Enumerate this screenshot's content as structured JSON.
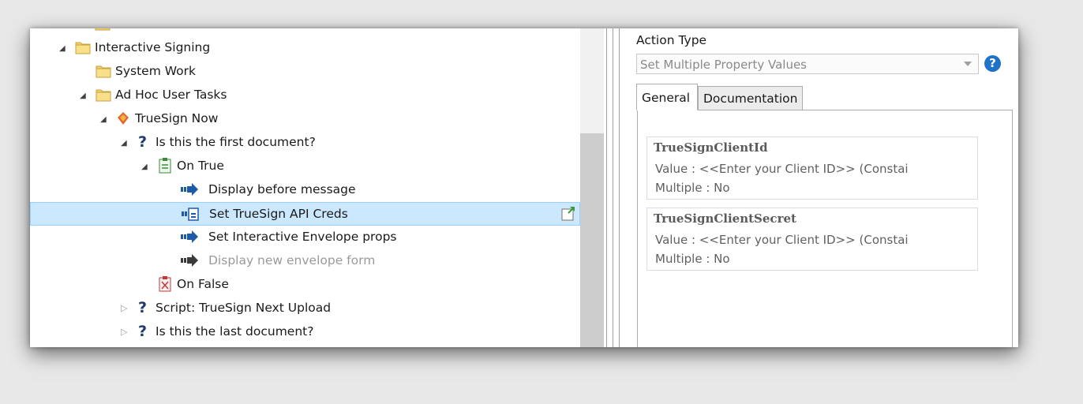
{
  "tree": {
    "items": [
      {
        "label": "Interactive Signing"
      },
      {
        "label": "System Work"
      },
      {
        "label": "Ad Hoc User Tasks"
      },
      {
        "label": "TrueSign Now"
      },
      {
        "label": "Is this the first document?"
      },
      {
        "label": "On True"
      },
      {
        "label": "Display before message"
      },
      {
        "label": "Set TrueSign API Creds"
      },
      {
        "label": "Set Interactive Envelope props"
      },
      {
        "label": "Display new envelope form"
      },
      {
        "label": "On False"
      },
      {
        "label": "Script: TrueSign Next Upload"
      },
      {
        "label": "Is this the last document?"
      }
    ]
  },
  "properties": {
    "action_type_label": "Action Type",
    "action_type_value": "Set Multiple Property Values",
    "help_glyph": "?",
    "tabs": [
      {
        "label": "General"
      },
      {
        "label": "Documentation"
      }
    ],
    "cards": [
      {
        "title": "TrueSignClientId",
        "value_line": "Value    : <<Enter your Client ID>> (Constai",
        "multiple_line": "Multiple : No"
      },
      {
        "title": "TrueSignClientSecret",
        "value_line": "Value    : <<Enter your Client ID>> (Constai",
        "multiple_line": "Multiple : No"
      }
    ]
  },
  "colors": {
    "selection": "#cce8ff",
    "folder": "#f3d36b",
    "action_arrow": "#1e5aa8",
    "help": "#1e73c8"
  }
}
